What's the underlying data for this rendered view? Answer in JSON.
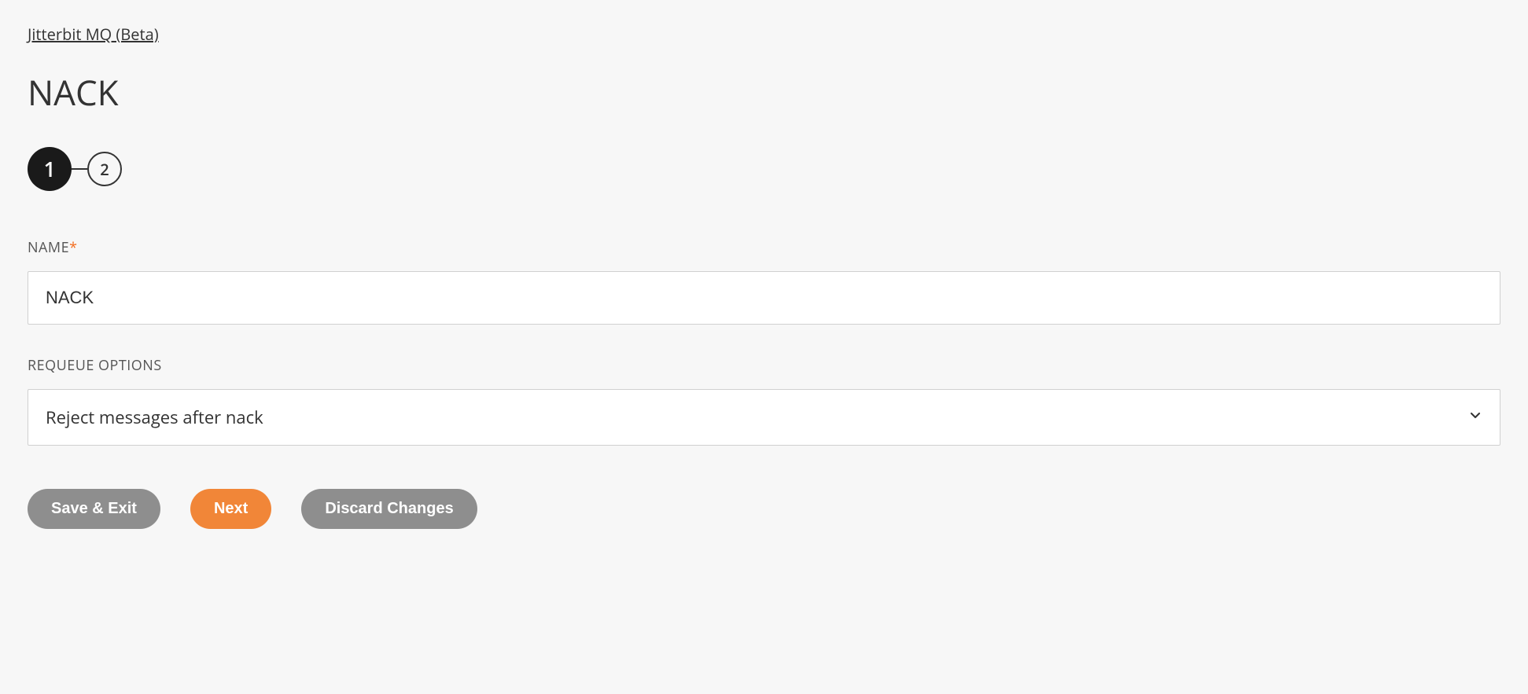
{
  "breadcrumb": "Jitterbit MQ (Beta)",
  "title": "NACK",
  "stepper": {
    "step1": "1",
    "step2": "2"
  },
  "fields": {
    "name": {
      "label": "NAME",
      "required_marker": "*",
      "value": "NACK"
    },
    "requeue": {
      "label": "REQUEUE OPTIONS",
      "selected": "Reject messages after nack"
    }
  },
  "buttons": {
    "save_exit": "Save & Exit",
    "next": "Next",
    "discard": "Discard Changes"
  }
}
